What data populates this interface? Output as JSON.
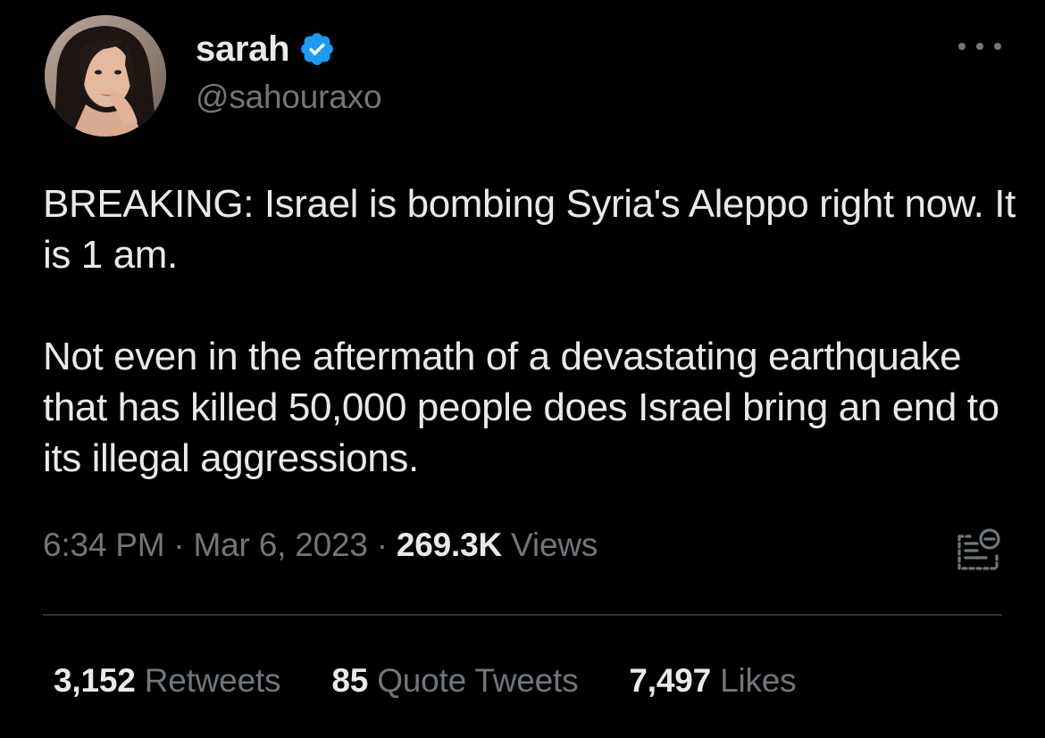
{
  "user": {
    "display_name": "sarah",
    "handle": "@sahouraxo",
    "verified": true
  },
  "tweet": {
    "paragraphs": [
      "BREAKING: Israel is bombing Syria's Aleppo right now. It is 1 am.",
      "Not even in the aftermath of a devastating earthquake that has killed 50,000 people does Israel bring an end to its illegal aggressions."
    ],
    "time": "6:34 PM",
    "separator": "·",
    "date": "Mar 6, 2023",
    "views_count": "269.3K",
    "views_label": "Views"
  },
  "stats": {
    "retweets_count": "3,152",
    "retweets_label": "Retweets",
    "quotes_count": "85",
    "quotes_label": "Quote Tweets",
    "likes_count": "7,497",
    "likes_label": "Likes"
  },
  "icons": {
    "verified": "verified-badge-icon",
    "more": "more-options-icon",
    "analytics": "tweet-analytics-icon"
  },
  "colors": {
    "background": "#000000",
    "primary_text": "#e7e9ea",
    "secondary_text": "#71767b",
    "verified_blue": "#1d9bf0",
    "divider": "#2f3336"
  }
}
